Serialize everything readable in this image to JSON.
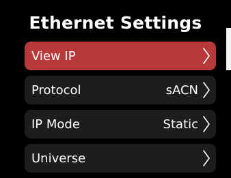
{
  "screen": {
    "title": "Ethernet Settings"
  },
  "menu": {
    "items": [
      {
        "label": "View IP",
        "value": "",
        "selected": true,
        "chevron_icon": "chevron-right-icon"
      },
      {
        "label": "Protocol",
        "value": "sACN",
        "selected": false,
        "chevron_icon": "chevron-right-icon"
      },
      {
        "label": "IP Mode",
        "value": "Static",
        "selected": false,
        "chevron_icon": "chevron-right-icon"
      },
      {
        "label": "Universe",
        "value": "",
        "selected": false,
        "chevron_icon": "chevron-right-icon"
      }
    ]
  },
  "colors": {
    "background": "#000000",
    "item_background": "#1d1d1d",
    "selected_background": "#b8393a",
    "text": "#ffffff",
    "scroll_indicator": "#f4f4f4"
  }
}
